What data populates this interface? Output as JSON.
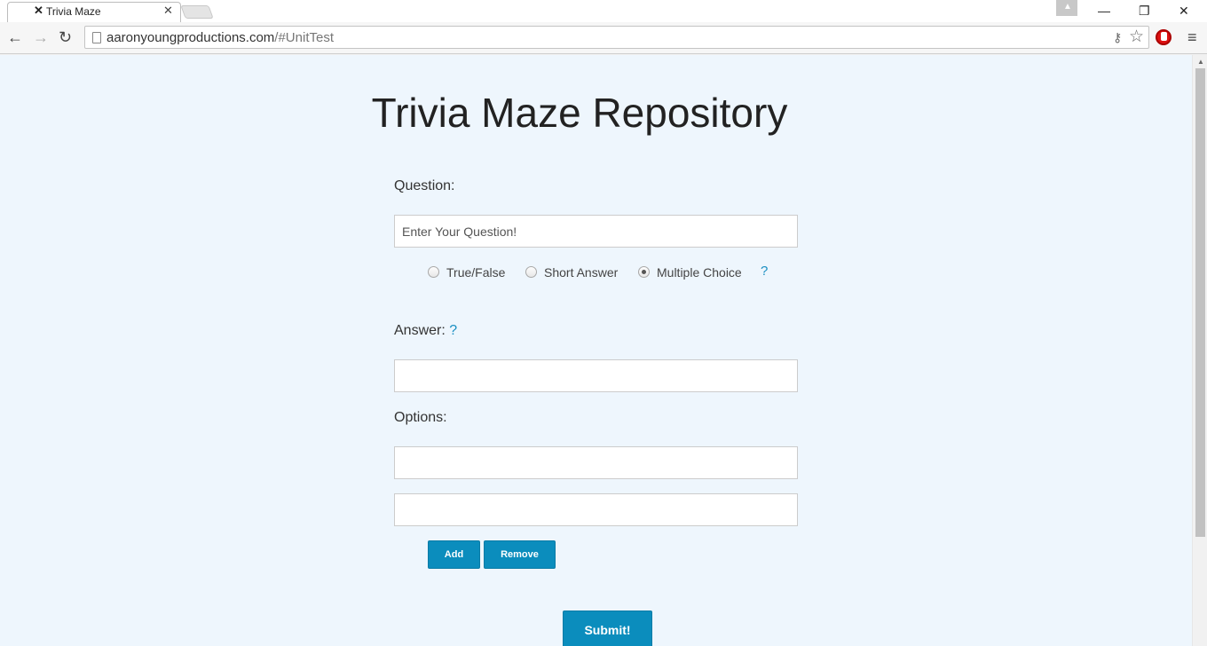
{
  "browser": {
    "tab_title": "Trivia Maze",
    "tab_favicon": "✕",
    "url_domain": "aaronyoungproductions.com",
    "url_path": "/#UnitTest",
    "icons": [
      "back-icon",
      "forward-icon",
      "reload-icon",
      "page-icon",
      "key-icon",
      "star-icon",
      "adblock-icon",
      "menu-icon",
      "minimize-icon",
      "restore-icon",
      "close-icon"
    ]
  },
  "page": {
    "title": "Trivia Maze Repository",
    "question_label": "Question:",
    "question_placeholder": "Enter Your Question!",
    "question_types": [
      {
        "label": "True/False",
        "checked": false
      },
      {
        "label": "Short Answer",
        "checked": false
      },
      {
        "label": "Multiple Choice",
        "checked": true
      }
    ],
    "help_symbol": "?",
    "answer_label": "Answer:",
    "answer_value": "",
    "options_label": "Options:",
    "options": [
      "",
      ""
    ],
    "add_label": "Add",
    "remove_label": "Remove",
    "submit_label": "Submit!"
  },
  "colors": {
    "page_background": "#eef6fd",
    "accent": "#0b8dbd",
    "help_link": "#1a8fc2"
  }
}
